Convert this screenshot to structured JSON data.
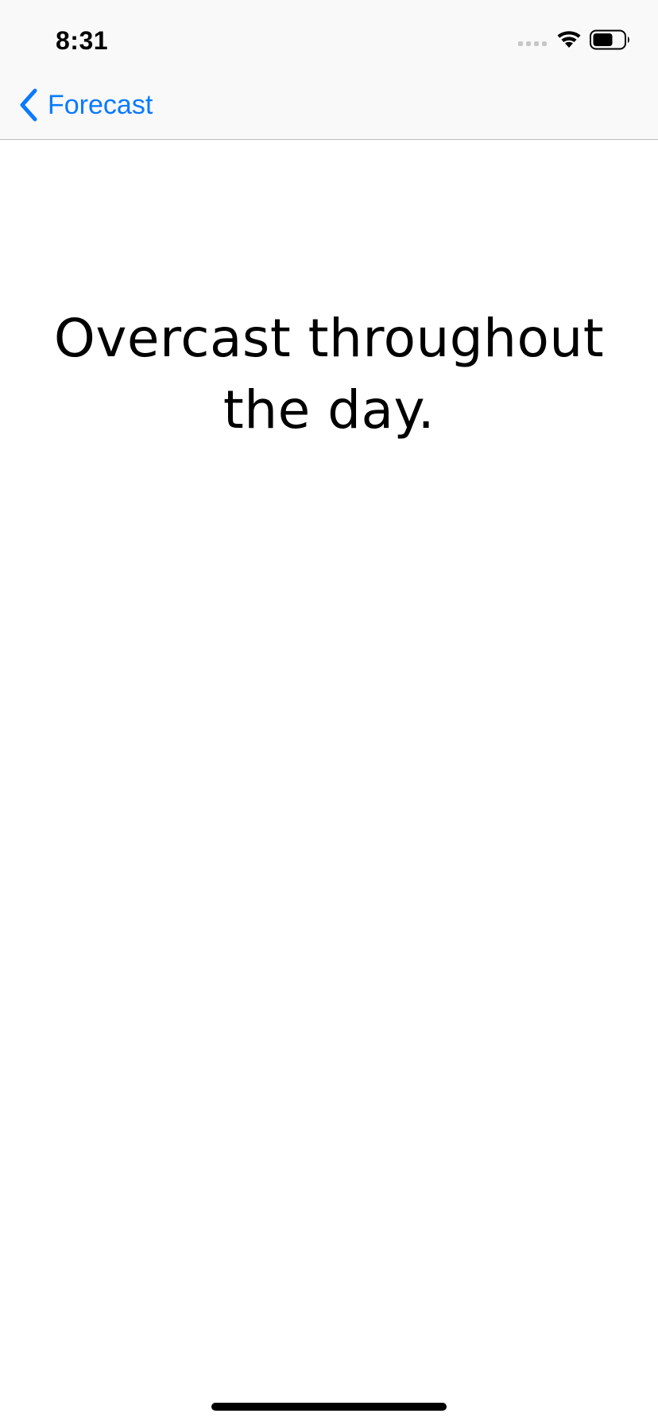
{
  "status_bar": {
    "time": "8:31",
    "signal_icon": "cellular-signal-icon",
    "wifi_icon": "wifi-icon",
    "battery_icon": "battery-icon"
  },
  "nav": {
    "back_icon": "chevron-left-icon",
    "back_label": "Forecast"
  },
  "main": {
    "headline": "Overcast throughout the day."
  },
  "colors": {
    "accent": "#0a7aff",
    "background": "#ffffff",
    "nav_background": "#f9f9f9",
    "text": "#000000"
  }
}
